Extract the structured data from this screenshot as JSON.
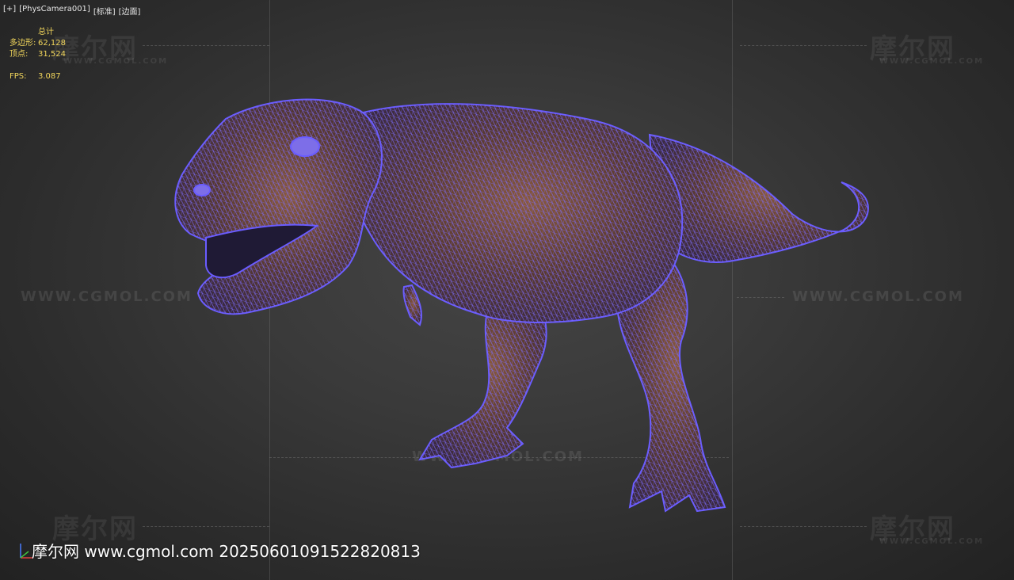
{
  "viewport": {
    "label_parts": [
      "[+]",
      "[PhysCamera001]",
      "[标准]",
      "[边面]"
    ]
  },
  "stats": {
    "header": "总计",
    "polygons_label": "多边形:",
    "polygons_value": "62,128",
    "vertices_label": "顶点:",
    "vertices_value": "31,524",
    "fps_label": "FPS:",
    "fps_value": "3.087"
  },
  "watermarks": {
    "cn": "摩尔网",
    "url_small": "WWW.CGMOL.COM",
    "url_big": "WWW.CGMOL.COM",
    "url_mid": "WWW.CGMOL.COM"
  },
  "footer": {
    "text": "摩尔网 www.cgmol.com 20250601091522820813"
  },
  "colors": {
    "wireframe": "#6a5cff",
    "stats_text": "#f2d65c",
    "skin_dark": "#4a2f2a",
    "skin_mid": "#7a4a35"
  }
}
